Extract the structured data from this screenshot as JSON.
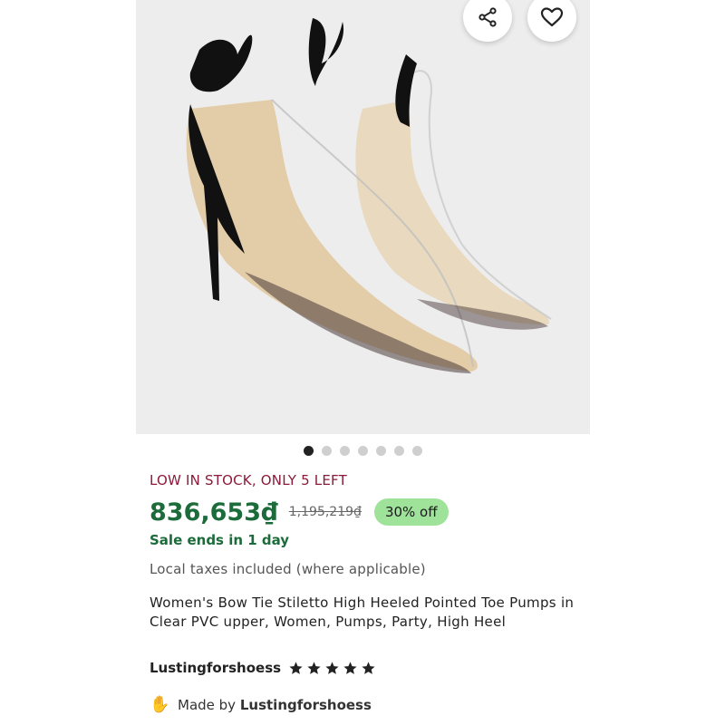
{
  "product": {
    "stock_notice": "LOW IN STOCK, ONLY 5 LEFT",
    "price": "836,653₫",
    "original_price": "1,195,219₫",
    "discount_badge": "30% off",
    "sale_ends": "Sale ends in 1 day",
    "tax_note": "Local taxes included (where applicable)",
    "title": "Women's Bow Tie Stiletto High Heeled Pointed Toe Pumps in Clear PVC upper, Women, Pumps, Party, High Heel"
  },
  "seller": {
    "name": "Lustingforshoess",
    "rating_stars": 5,
    "made_by_prefix": "Made by",
    "made_by_name": "Lustingforshoess"
  },
  "gallery": {
    "image_count": 7,
    "active_index": 0
  },
  "actions": {
    "share_icon": "share-icon",
    "favorite_icon": "heart-icon"
  },
  "colors": {
    "price_green": "#1c6b3a",
    "stock_red": "#8b1a3a",
    "badge_green": "#9fe29a"
  }
}
